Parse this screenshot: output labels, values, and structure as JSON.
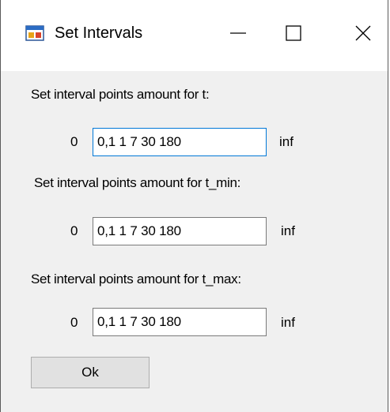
{
  "window": {
    "title": "Set Intervals",
    "title_icon": "app-form-icon",
    "controls": {
      "minimize_icon": "minimize-icon",
      "maximize_icon": "maximize-icon",
      "close_icon": "close-icon"
    }
  },
  "groups": [
    {
      "label": "Set interval points amount for t:",
      "lower": "0",
      "value": "0,1 1 7 30 180",
      "upper": "inf",
      "focused": true
    },
    {
      "label": "Set interval points amount for t_min:",
      "lower": "0",
      "value": "0,1 1 7 30 180",
      "upper": "inf",
      "focused": false
    },
    {
      "label": "Set interval points amount for t_max:",
      "lower": "0",
      "value": "0,1 1 7 30 180",
      "upper": "inf",
      "focused": false
    }
  ],
  "ok_button": {
    "label": "Ok"
  },
  "colors": {
    "window_bg": "#f0f0f0",
    "titlebar_bg": "#ffffff",
    "focus_border": "#0078d7",
    "button_bg": "#e1e1e1"
  }
}
